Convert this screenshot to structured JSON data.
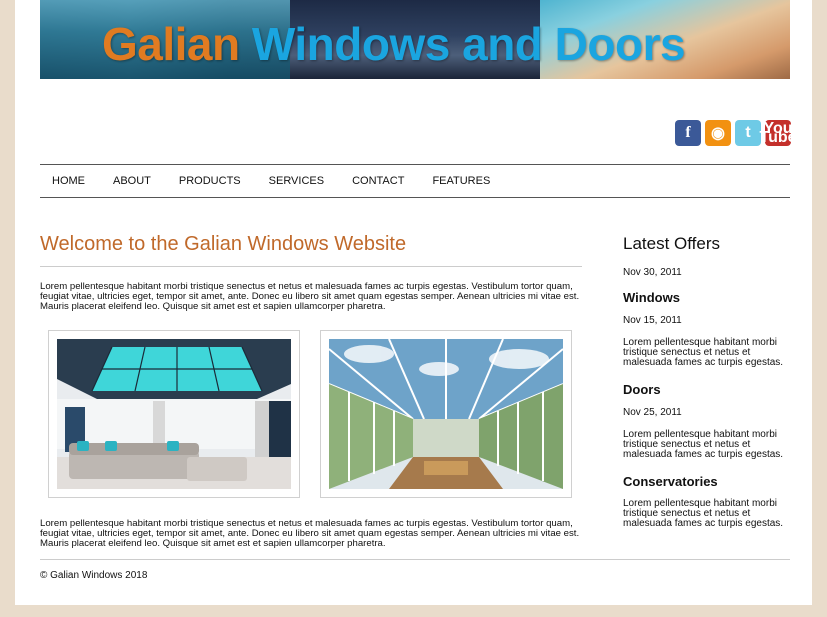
{
  "banner": {
    "title_part1": "Galian",
    "title_part2": "Windows and Doors"
  },
  "social": [
    {
      "icon": "facebook-icon",
      "glyph": "f"
    },
    {
      "icon": "rss-icon",
      "glyph": "◉"
    },
    {
      "icon": "twitter-icon",
      "glyph": "t"
    },
    {
      "icon": "youtube-icon",
      "glyph_top": "You",
      "glyph_bottom": "Tube"
    }
  ],
  "nav": [
    "HOME",
    "ABOUT",
    "PRODUCTS",
    "SERVICES",
    "CONTACT",
    "FEATURES"
  ],
  "main": {
    "heading": "Welcome to the Galian Windows Website",
    "para1": "Lorem pellentesque habitant morbi tristique senectus et netus et malesuada fames ac turpis egestas. Vestibulum tortor quam, feugiat vitae, ultricies eget, tempor sit amet, ante. Donec eu libero sit amet quam egestas semper. Aenean ultricies mi vitae est. Mauris placerat eleifend leo. Quisque sit amet est et sapien ullamcorper pharetra.",
    "para2": "Lorem pellentesque habitant morbi tristique senectus et netus et malesuada fames ac turpis egestas. Vestibulum tortor quam, feugiat vitae, ultricies eget, tempor sit amet, ante. Donec eu libero sit amet quam egestas semper. Aenean ultricies mi vitae est. Mauris placerat eleifend leo. Quisque sit amet est et sapien ullamcorper pharetra."
  },
  "sidebar": {
    "heading": "Latest Offers",
    "date0": "Nov 30, 2011",
    "items": [
      {
        "title": "Windows",
        "date": "Nov 15, 2011",
        "text": "Lorem pellentesque habitant morbi tristique senectus et netus et malesuada fames ac turpis egestas."
      },
      {
        "title": "Doors",
        "date": "Nov 25, 2011",
        "text": "Lorem pellentesque habitant morbi tristique senectus et netus et malesuada fames ac turpis egestas."
      },
      {
        "title": "Conservatories",
        "text": "Lorem pellentesque habitant morbi tristique senectus et netus et malesuada fames ac turpis egestas."
      }
    ]
  },
  "footer": {
    "copyright": "© Galian Windows 2018"
  },
  "colors": {
    "accent": "#c0692a",
    "banner_orange": "#e07b21",
    "banner_blue": "#1aa5e0",
    "background": "#e9dccb"
  }
}
